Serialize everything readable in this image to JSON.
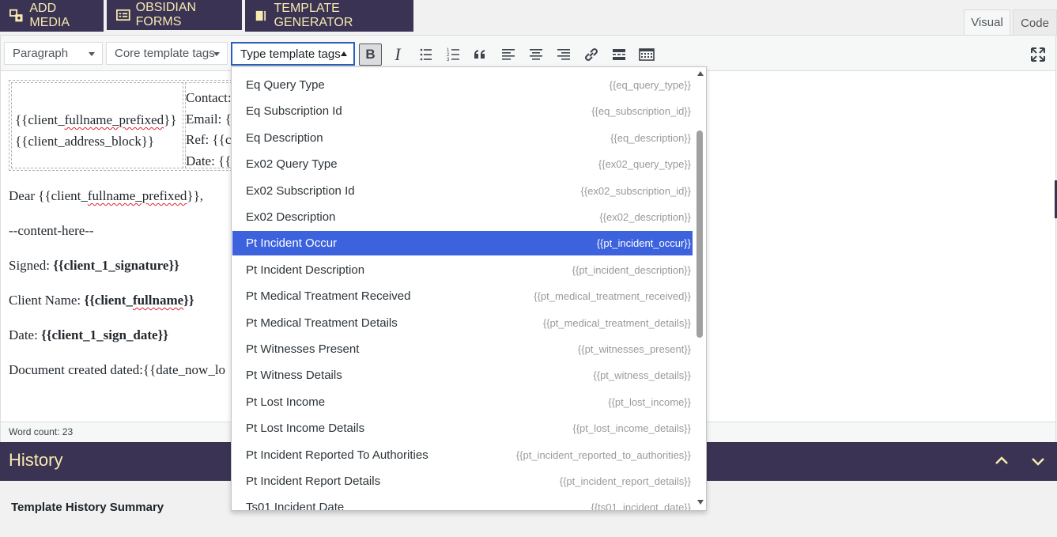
{
  "top_buttons": {
    "add_media": "ADD MEDIA",
    "obsidian_forms": "OBSIDIAN FORMS",
    "template_generator": "TEMPLATE GENERATOR"
  },
  "tabs": {
    "visual": "Visual",
    "code": "Code"
  },
  "toolbar": {
    "paragraph": "Paragraph",
    "core_tags": "Core template tags",
    "type_tags": "Type template tags",
    "bold": "B",
    "italic": "I"
  },
  "content": {
    "addr_left": [
      "{{client_fullname_prefixed}}",
      "{{client_address_block}}"
    ],
    "addr_right": [
      "Contact: {",
      "Email: {{",
      "Ref: {{c",
      "Date: {{"
    ],
    "dear_prefix": "Dear {{client_",
    "dear_squig": "fullname_prefixed",
    "dear_suffix": "}},",
    "content_here": "--content-here--",
    "signed_label": "Signed: ",
    "signed_value": "{{client_1_signature}}",
    "client_name_label": "Client Name: ",
    "client_name_pre": "{{client_",
    "client_name_squig": "fullname",
    "client_name_post": "}}",
    "date_label": "Date: ",
    "date_value": "{{client_1_sign_date}}",
    "doc_created": "Document created dated:{{date_now_lo"
  },
  "status": {
    "word_count": "Word count: 23"
  },
  "history": {
    "title": "History",
    "summary": "Template History Summary"
  },
  "dropdown": {
    "items": [
      {
        "label": "Eq Query Type",
        "tag": "{{eq_query_type}}"
      },
      {
        "label": "Eq Subscription Id",
        "tag": "{{eq_subscription_id}}"
      },
      {
        "label": "Eq Description",
        "tag": "{{eq_description}}"
      },
      {
        "label": "Ex02 Query Type",
        "tag": "{{ex02_query_type}}"
      },
      {
        "label": "Ex02 Subscription Id",
        "tag": "{{ex02_subscription_id}}"
      },
      {
        "label": "Ex02 Description",
        "tag": "{{ex02_description}}"
      },
      {
        "label": "Pt Incident Occur",
        "tag": "{{pt_incident_occur}}"
      },
      {
        "label": "Pt Incident Description",
        "tag": "{{pt_incident_description}}"
      },
      {
        "label": "Pt Medical Treatment Received",
        "tag": "{{pt_medical_treatment_received}}"
      },
      {
        "label": "Pt Medical Treatment Details",
        "tag": "{{pt_medical_treatment_details}}"
      },
      {
        "label": "Pt Witnesses Present",
        "tag": "{{pt_witnesses_present}}"
      },
      {
        "label": "Pt Witness Details",
        "tag": "{{pt_witness_details}}"
      },
      {
        "label": "Pt Lost Income",
        "tag": "{{pt_lost_income}}"
      },
      {
        "label": "Pt Lost Income Details",
        "tag": "{{pt_lost_income_details}}"
      },
      {
        "label": "Pt Incident Reported To Authorities",
        "tag": "{{pt_incident_reported_to_authorities}}"
      },
      {
        "label": "Pt Incident Report Details",
        "tag": "{{pt_incident_report_details}}"
      },
      {
        "label": "Ts01 Incident Date",
        "tag": "{{ts01_incident_date}}"
      }
    ],
    "active_index": 6
  },
  "colors": {
    "brand_purple": "#3b3353",
    "brand_yellow": "#f7ebb0",
    "highlight_blue": "#3c62dd"
  }
}
